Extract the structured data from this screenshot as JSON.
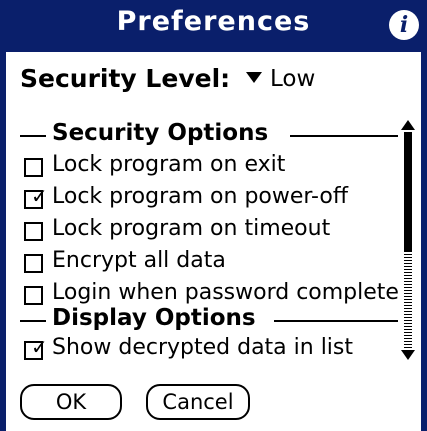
{
  "window": {
    "title": "Preferences",
    "info_icon": "info-icon"
  },
  "security": {
    "label": "Security Level:",
    "value": "Low"
  },
  "sections": [
    {
      "header": "Security Options",
      "options": [
        {
          "label": "Lock program on exit",
          "checked": false
        },
        {
          "label": "Lock program on power-off",
          "checked": true
        },
        {
          "label": "Lock program on timeout",
          "checked": false
        },
        {
          "label": "Encrypt all data",
          "checked": false
        },
        {
          "label": "Login when password complete",
          "checked": false
        }
      ]
    },
    {
      "header": "Display Options",
      "options": [
        {
          "label": "Show decrypted data in list",
          "checked": true
        }
      ]
    }
  ],
  "buttons": {
    "ok": "OK",
    "cancel": "Cancel"
  },
  "colors": {
    "titlebar": "#0a1f6b",
    "background": "#ffffff",
    "text": "#000000"
  }
}
